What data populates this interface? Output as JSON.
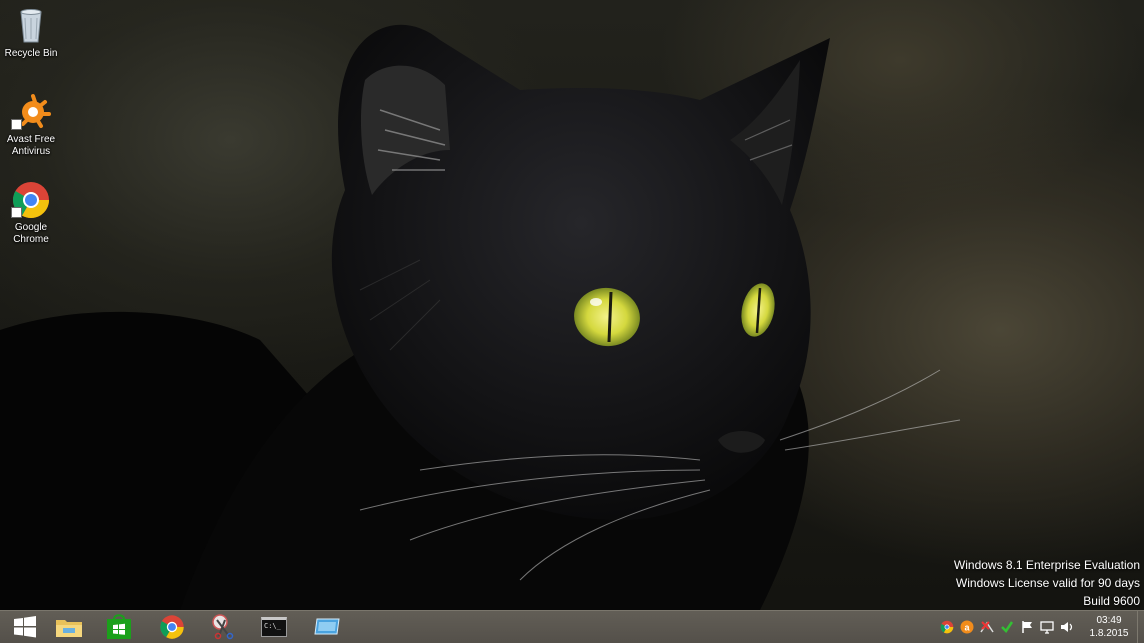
{
  "desktop": {
    "icons": [
      {
        "label": "Recycle Bin",
        "icon": "recycle-bin-icon"
      },
      {
        "label": "Avast Free Antivirus",
        "icon": "avast-icon"
      },
      {
        "label": "Google Chrome",
        "icon": "chrome-icon"
      }
    ]
  },
  "watermark": {
    "line1": "Windows 8.1 Enterprise Evaluation",
    "line2": "Windows License valid for 90 days",
    "line3": "Build 9600"
  },
  "taskbar": {
    "pinned": [
      {
        "name": "start-button",
        "icon": "windows-logo-icon"
      },
      {
        "name": "file-explorer",
        "icon": "folder-icon"
      },
      {
        "name": "store",
        "icon": "store-icon"
      },
      {
        "name": "chrome",
        "icon": "chrome-icon"
      },
      {
        "name": "snipping-tool",
        "icon": "scissors-icon"
      },
      {
        "name": "command-prompt",
        "icon": "cmd-icon"
      },
      {
        "name": "remote-desktop",
        "icon": "remote-desktop-icon"
      }
    ],
    "cmd_text": "C:\\_",
    "tray": {
      "icons": [
        "chrome-icon",
        "avast-icon",
        "network-error-icon",
        "checkmark-icon",
        "flag-icon",
        "monitor-icon",
        "volume-icon"
      ],
      "time": "03:49",
      "date": "1.8.2015"
    }
  },
  "colors": {
    "taskbar": "#5a564f",
    "store_green": "#1ba01b",
    "windows_blue": "#ffffff",
    "cat_eye": "#d8e04a"
  }
}
